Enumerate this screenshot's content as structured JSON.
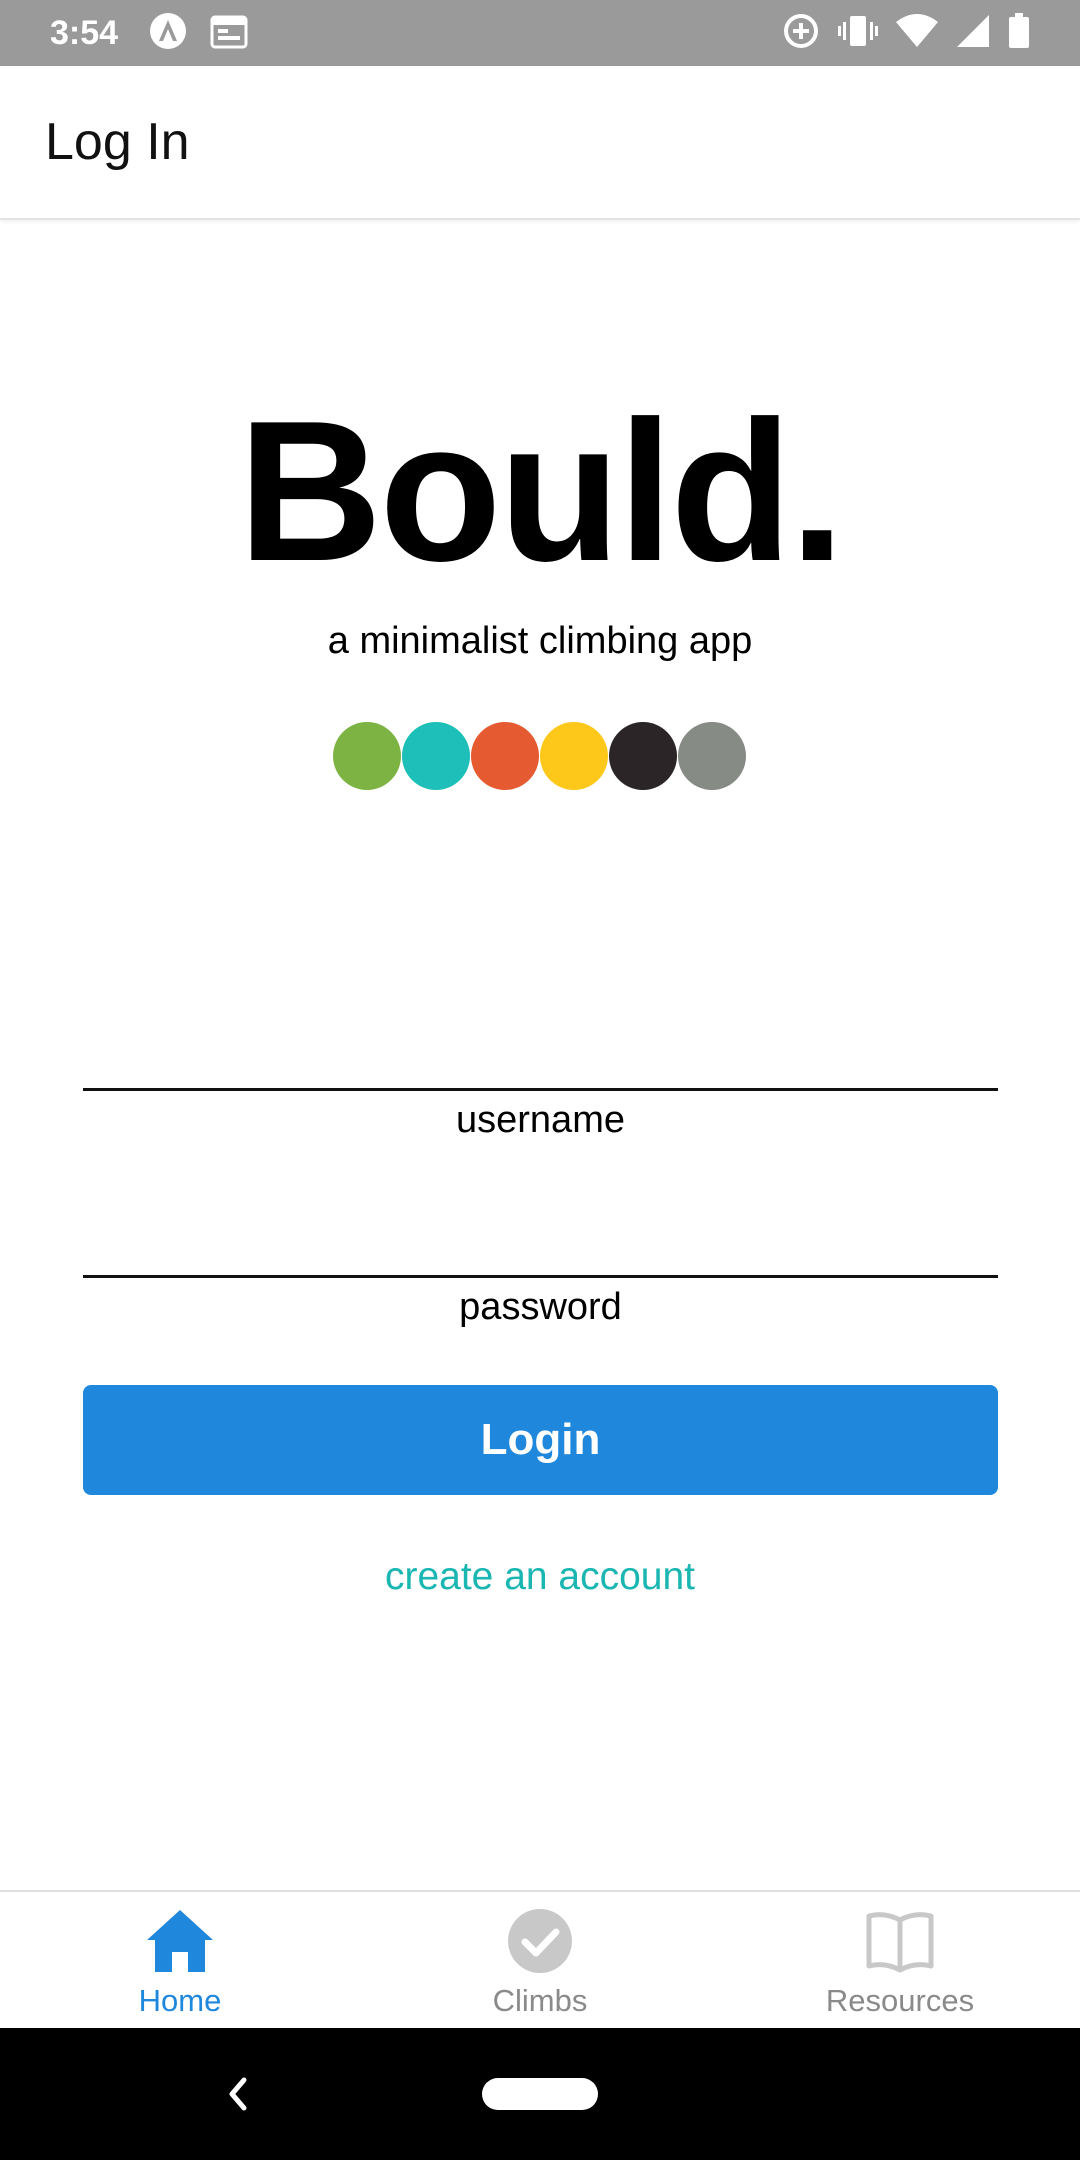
{
  "status_bar": {
    "time": "3:54",
    "icons": [
      "app-icon",
      "calendar-icon",
      "data-saver-icon",
      "vibrate-icon",
      "wifi-icon",
      "signal-icon",
      "battery-icon"
    ]
  },
  "app_bar": {
    "title": "Log In"
  },
  "hero": {
    "logo": "Bould.",
    "tagline": "a minimalist climbing app",
    "dot_colors": [
      "#7cb342",
      "#1dbfb8",
      "#e55a30",
      "#fdc81a",
      "#2b2527",
      "#868b86"
    ]
  },
  "form": {
    "username": {
      "label": "username",
      "value": ""
    },
    "password": {
      "label": "password",
      "value": ""
    },
    "login_label": "Login",
    "create_account_label": "create an account"
  },
  "bottom_nav": {
    "active_color": "#2088dc",
    "inactive_color": "#8a8a8a",
    "items": [
      {
        "label": "Home",
        "icon": "home-icon",
        "active": true
      },
      {
        "label": "Climbs",
        "icon": "check-circle-icon",
        "active": false
      },
      {
        "label": "Resources",
        "icon": "book-icon",
        "active": false
      }
    ]
  },
  "colors": {
    "primary": "#2088dc",
    "link": "#1ab6b2",
    "status_bar": "#9a9a9a"
  }
}
